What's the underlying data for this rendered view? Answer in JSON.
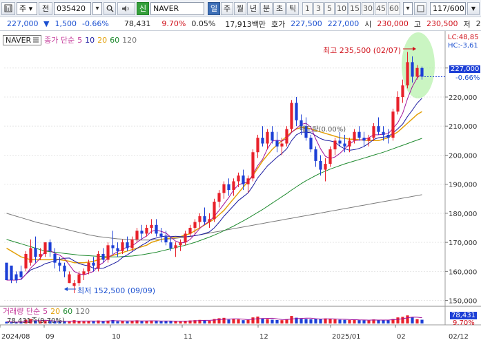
{
  "toolbar": {
    "market": "주",
    "chart_icon": "전",
    "code": "035420",
    "search_icon": "search-icon",
    "sound_icon": "speaker-icon",
    "new_badge": "신",
    "name": "NAVER",
    "periods": [
      "일",
      "주",
      "월",
      "년",
      "분",
      "초",
      "틱"
    ],
    "active_period": "일",
    "nums": [
      "1",
      "3",
      "5",
      "10",
      "15",
      "30",
      "45",
      "60"
    ],
    "count": "117/600"
  },
  "infobar": {
    "price": "227,000",
    "change": "1,500",
    "change_pct": "-0.66%",
    "volume": "78,431",
    "vol_ratio": "9.70%",
    "turnover": "0.05%",
    "trade_value": "17,913백만",
    "quote_label": "호가",
    "ask": "227,500",
    "bid": "227,000",
    "open_label": "시",
    "open": "230,000",
    "high_label": "고",
    "high": "230,500",
    "low_label": "저",
    "low": "2"
  },
  "price_panel": {
    "stock_label": "NAVER",
    "legend_title": "종가 단순",
    "ma_periods": [
      "5",
      "10",
      "20",
      "60",
      "120"
    ],
    "ma_colors": [
      "#1a1aa0",
      "#a0109a",
      "#e3a008",
      "#1e8a2e",
      "#7a7a7a"
    ],
    "high_annotation": "최고 235,500 (02/07)",
    "low_annotation": "최저 152,500 (09/09)",
    "mid_annotation": "매도량(0.00%)",
    "lc_label": "LC:48,85",
    "hc_label": "HC:-3,61",
    "cur_price_label": "227,000",
    "cur_pct_label": "-0.66%"
  },
  "volume_panel": {
    "legend_title": "거래량 단순",
    "ma_periods": [
      "5",
      "20",
      "60",
      "120"
    ],
    "vol_text": "78,431주(9.70%)",
    "cur_vol_label": "78,431",
    "cur_vol_pct": "9.70%"
  },
  "x_labels": [
    "2024/08",
    "09",
    "10",
    "11",
    "12",
    "2025/01",
    "02",
    "02/12"
  ],
  "y_ticks": [
    "230,000",
    "220,000",
    "210,000",
    "200,000",
    "190,000",
    "180,000",
    "170,000",
    "160,000",
    "150,000"
  ],
  "colors": {
    "up": "#e8212b",
    "down": "#1c3fd6",
    "accent": "#3d6fb7",
    "highlight": "#a7ee9a"
  },
  "chart_data": {
    "type": "candlestick",
    "y_range": [
      148000,
      238000
    ],
    "candles": [
      [
        163000,
        162000,
        158000,
        157000
      ],
      [
        162000,
        158000,
        156000,
        157000
      ],
      [
        159000,
        160000,
        156000,
        157000
      ],
      [
        160000,
        162000,
        157000,
        158000
      ],
      [
        161000,
        167000,
        160000,
        166000
      ],
      [
        163000,
        171000,
        162000,
        168000
      ],
      [
        168000,
        172000,
        163000,
        165000
      ],
      [
        165000,
        168000,
        164000,
        166000
      ],
      [
        166000,
        170000,
        165000,
        170000
      ],
      [
        170000,
        171000,
        165000,
        167000
      ],
      [
        166000,
        168000,
        161000,
        163000
      ],
      [
        163000,
        165000,
        160000,
        162000
      ],
      [
        162000,
        163000,
        158000,
        160000
      ],
      [
        156000,
        160000,
        156000,
        159000
      ],
      [
        155000,
        157000,
        152500,
        156000
      ],
      [
        156000,
        160000,
        155000,
        159000
      ],
      [
        159000,
        161000,
        157000,
        160000
      ],
      [
        160000,
        164000,
        159000,
        163000
      ],
      [
        163000,
        165000,
        160000,
        162000
      ],
      [
        161000,
        167000,
        160000,
        166000
      ],
      [
        166000,
        168000,
        163000,
        164000
      ],
      [
        164000,
        170000,
        163000,
        169000
      ],
      [
        169000,
        174000,
        166000,
        168000
      ],
      [
        168000,
        170000,
        165000,
        167000
      ],
      [
        167000,
        171000,
        166000,
        170000
      ],
      [
        170000,
        172000,
        167000,
        168000
      ],
      [
        168000,
        172000,
        167000,
        171000
      ],
      [
        171000,
        175000,
        170000,
        174000
      ],
      [
        174000,
        176000,
        171000,
        173000
      ],
      [
        173000,
        176000,
        172000,
        175000
      ],
      [
        175000,
        178000,
        173000,
        176000
      ],
      [
        176000,
        178000,
        172000,
        173000
      ],
      [
        173000,
        175000,
        170000,
        172000
      ],
      [
        172000,
        174000,
        169000,
        170000
      ],
      [
        170000,
        172000,
        167000,
        168000
      ],
      [
        168000,
        170000,
        165000,
        169000
      ],
      [
        169000,
        171000,
        167000,
        170000
      ],
      [
        170000,
        174000,
        169000,
        173000
      ],
      [
        173000,
        176000,
        172000,
        175000
      ],
      [
        175000,
        178000,
        173000,
        177000
      ],
      [
        177000,
        180000,
        175000,
        179000
      ],
      [
        179000,
        182000,
        176000,
        177000
      ],
      [
        177000,
        180000,
        175000,
        178000
      ],
      [
        178000,
        185000,
        177000,
        184000
      ],
      [
        184000,
        188000,
        182000,
        187000
      ],
      [
        187000,
        191000,
        185000,
        190000
      ],
      [
        190000,
        192000,
        186000,
        188000
      ],
      [
        188000,
        192000,
        186000,
        191000
      ],
      [
        191000,
        194000,
        189000,
        193000
      ],
      [
        193000,
        195000,
        188000,
        190000
      ],
      [
        190000,
        193000,
        187000,
        192000
      ],
      [
        192000,
        202000,
        191000,
        201000
      ],
      [
        201000,
        207000,
        199000,
        206000
      ],
      [
        206000,
        210000,
        203000,
        204000
      ],
      [
        204000,
        209000,
        202000,
        208000
      ],
      [
        208000,
        210000,
        204000,
        205000
      ],
      [
        205000,
        208000,
        201000,
        203000
      ],
      [
        203000,
        206000,
        200000,
        204000
      ],
      [
        204000,
        210000,
        203000,
        209000
      ],
      [
        209000,
        219000,
        208000,
        218000
      ],
      [
        218000,
        220000,
        210000,
        212000
      ],
      [
        212000,
        214000,
        207000,
        210000
      ],
      [
        210000,
        213000,
        205000,
        206000
      ],
      [
        206000,
        207000,
        201000,
        202000
      ],
      [
        202000,
        203000,
        196000,
        198000
      ],
      [
        198000,
        200000,
        193000,
        195000
      ],
      [
        195000,
        199000,
        191000,
        197000
      ],
      [
        197000,
        203000,
        196000,
        202000
      ],
      [
        202000,
        206000,
        200000,
        205000
      ],
      [
        205000,
        208000,
        203000,
        204000
      ],
      [
        204000,
        207000,
        201000,
        203000
      ],
      [
        203000,
        206000,
        201000,
        205000
      ],
      [
        205000,
        209000,
        204000,
        208000
      ],
      [
        208000,
        210000,
        205000,
        206000
      ],
      [
        206000,
        208000,
        203000,
        205000
      ],
      [
        205000,
        207000,
        203000,
        206000
      ],
      [
        206000,
        211000,
        205000,
        210000
      ],
      [
        210000,
        213000,
        207000,
        208000
      ],
      [
        208000,
        210000,
        205000,
        207000
      ],
      [
        207000,
        209000,
        204000,
        206000
      ],
      [
        206000,
        216000,
        205000,
        215000
      ],
      [
        215000,
        222000,
        214000,
        220000
      ],
      [
        220000,
        226000,
        218000,
        224000
      ],
      [
        224000,
        235500,
        223000,
        232000
      ],
      [
        232000,
        234000,
        225000,
        227000
      ],
      [
        227000,
        231000,
        226000,
        230000
      ],
      [
        230000,
        230500,
        226000,
        227000
      ]
    ],
    "volume_max": 1000000,
    "volumes": [
      120000,
      90000,
      80000,
      95000,
      260000,
      310000,
      220000,
      150000,
      180000,
      160000,
      140000,
      130000,
      150000,
      160000,
      230000,
      170000,
      140000,
      160000,
      150000,
      210000,
      160000,
      190000,
      240000,
      150000,
      170000,
      140000,
      190000,
      220000,
      160000,
      170000,
      200000,
      180000,
      150000,
      160000,
      170000,
      150000,
      140000,
      190000,
      210000,
      230000,
      250000,
      220000,
      190000,
      310000,
      360000,
      390000,
      270000,
      300000,
      280000,
      230000,
      240000,
      420000,
      480000,
      350000,
      300000,
      260000,
      240000,
      230000,
      300000,
      520000,
      400000,
      320000,
      310000,
      290000,
      330000,
      300000,
      350000,
      320000,
      280000,
      260000,
      250000,
      240000,
      270000,
      230000,
      220000,
      210000,
      280000,
      260000,
      230000,
      220000,
      310000,
      420000,
      460000,
      560000,
      430000,
      300000,
      260000
    ],
    "ma_lines": {
      "ma20": [
        168,
        167,
        166,
        165,
        164.5,
        164,
        164,
        164,
        164,
        164,
        164.2,
        164,
        163.8,
        163.5,
        163,
        163,
        163,
        163.2,
        163.5,
        164,
        164.5,
        165,
        165.5,
        166,
        166.5,
        167,
        167.5,
        168,
        168.5,
        169,
        170,
        170.5,
        171,
        171.3,
        171.5,
        171.8,
        172,
        172.5,
        173,
        174,
        175,
        176,
        177,
        178,
        179.5,
        181,
        183,
        185,
        187,
        189,
        191,
        193,
        195.5,
        198,
        200,
        202,
        203.5,
        205,
        206.5,
        208,
        209,
        209.5,
        209.5,
        209,
        208.5,
        208,
        207.5,
        207,
        206.5,
        206,
        205.8,
        205.5,
        205.5,
        205.3,
        205.2,
        205,
        205,
        205,
        205.5,
        206,
        207,
        208,
        209.5,
        211,
        212.5,
        214,
        215
      ],
      "ma60": [
        171,
        170.5,
        170,
        169.5,
        169,
        168.5,
        168,
        167.5,
        167,
        166.8,
        166.6,
        166.4,
        166.2,
        166,
        165.8,
        165.6,
        165.5,
        165.4,
        165.3,
        165.2,
        165.1,
        165,
        165,
        165,
        165.1,
        165.2,
        165.3,
        165.5,
        165.7,
        166,
        166.3,
        166.6,
        167,
        167.4,
        167.8,
        168.2,
        168.6,
        169,
        169.5,
        170,
        170.6,
        171.2,
        171.8,
        172.5,
        173.2,
        174,
        174.8,
        175.6,
        176.5,
        177.4,
        178.3,
        179.3,
        180.3,
        181.3,
        182.4,
        183.5,
        184.6,
        185.7,
        186.8,
        188,
        189.1,
        190.2,
        191.2,
        192.1,
        193,
        193.8,
        194.5,
        195.2,
        195.8,
        196.4,
        197,
        197.5,
        198,
        198.5,
        199,
        199.5,
        200,
        200.5,
        201,
        201.6,
        202.2,
        202.8,
        203.4,
        204,
        204.6,
        205.2,
        205.8
      ],
      "ma120": [
        180,
        179.5,
        179,
        178.5,
        178,
        177.5,
        177,
        176.6,
        176.2,
        175.8,
        175.4,
        175,
        174.6,
        174.2,
        173.8,
        173.4,
        173,
        172.6,
        172.3,
        172,
        171.8,
        171.6,
        171.4,
        171.2,
        171.1,
        171,
        170.9,
        170.8,
        170.8,
        170.8,
        170.8,
        170.9,
        171,
        171.1,
        171.2,
        171.4,
        171.6,
        171.8,
        172,
        172.3,
        172.6,
        172.9,
        173.2,
        173.5,
        173.8,
        174.1,
        174.4,
        174.7,
        175,
        175.3,
        175.6,
        175.9,
        176.2,
        176.5,
        176.8,
        177.1,
        177.4,
        177.7,
        178,
        178.3,
        178.6,
        178.9,
        179.2,
        179.5,
        179.8,
        180.1,
        180.4,
        180.7,
        181,
        181.3,
        181.6,
        181.9,
        182.2,
        182.5,
        182.8,
        183.1,
        183.4,
        183.7,
        184,
        184.3,
        184.6,
        184.9,
        185.2,
        185.5,
        185.8,
        186.1,
        186.4
      ]
    }
  }
}
